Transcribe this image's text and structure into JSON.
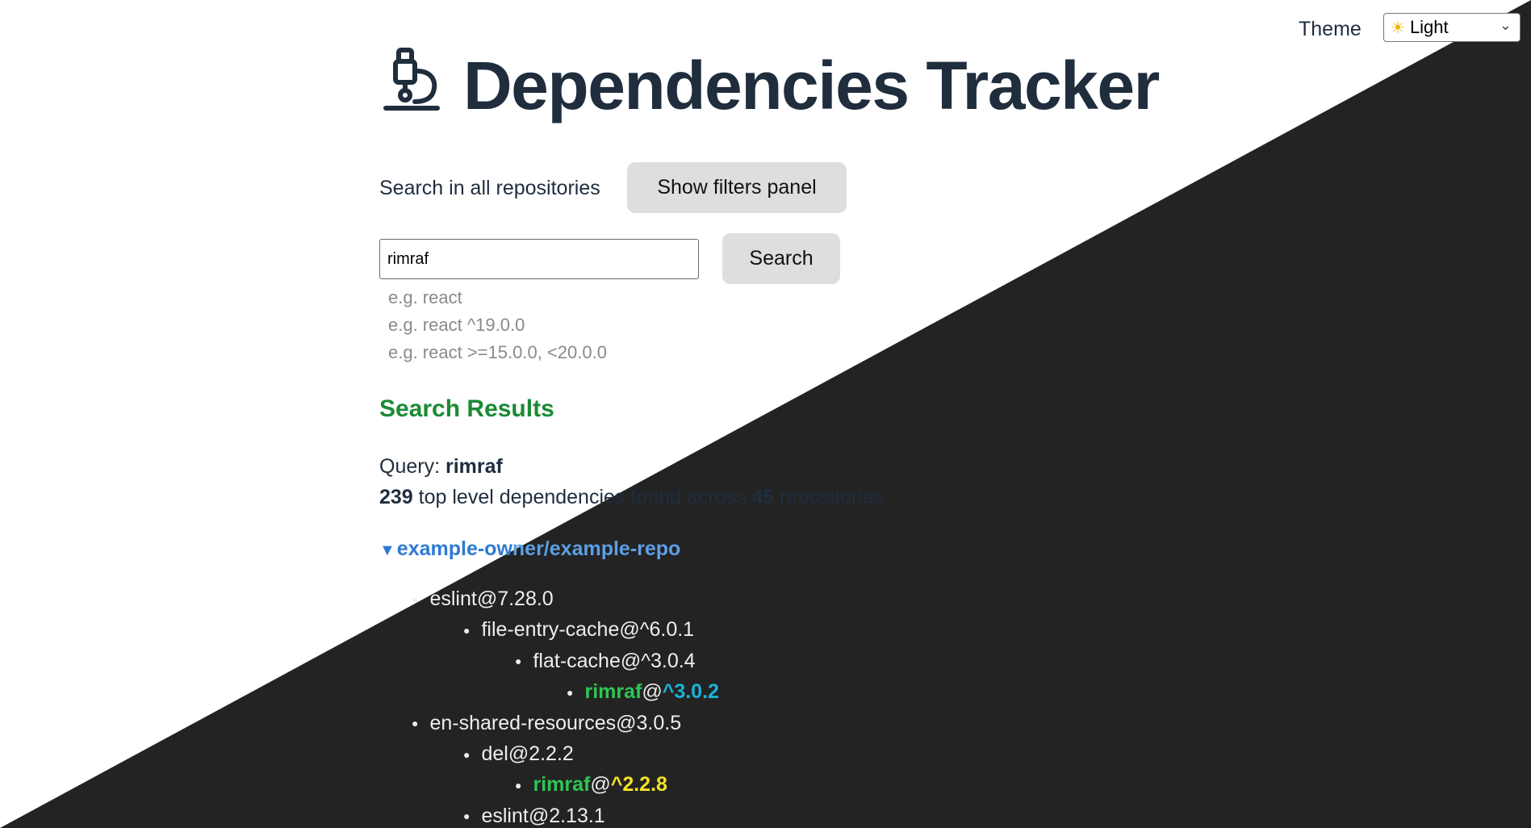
{
  "theme": {
    "label": "Theme",
    "selected": "Light",
    "icon": "sun-emoji"
  },
  "header": {
    "title": "Dependencies Tracker",
    "logo_icon": "microscope-icon"
  },
  "search": {
    "scope_label": "Search in all repositories",
    "filters_button": "Show filters panel",
    "input_value": "rimraf",
    "submit_label": "Search",
    "hints": [
      "e.g. react",
      "e.g. react ^19.0.0",
      "e.g. react >=15.0.0, <20.0.0"
    ]
  },
  "results": {
    "heading": "Search Results",
    "query_label": "Query:",
    "query_value": "rimraf",
    "count_deps": "239",
    "count_text_a": "top level dependencies found across",
    "count_repos": "45",
    "count_text_b": "repositories",
    "repo_name_a": "example-ow",
    "repo_name_b": "ner/example-repo",
    "tree": [
      {
        "text": "eslint@7.28.0",
        "level": 0
      },
      {
        "text": "file-entry-cache@^6.0.1",
        "level": 1
      },
      {
        "text": "flat-cache@^3.0.4",
        "level": 2
      },
      {
        "name": "rimraf",
        "at": "@",
        "version": "^3.0.2",
        "level": 3,
        "version_color": "#1ab3d6"
      },
      {
        "text": "en-shared-resources@3.0.5",
        "level": 0
      },
      {
        "text": "del@2.2.2",
        "level": 1
      },
      {
        "name": "rimraf",
        "at": "@",
        "version": "^2.2.8",
        "level": 2,
        "version_color": "#f3e224"
      },
      {
        "text": "eslint@2.13.1",
        "level": 1
      }
    ]
  },
  "colors": {
    "accent_green": "#1a8a34",
    "link_blue": "#2e7ad3",
    "dark_bg": "#232323",
    "title": "#1f2d3d"
  }
}
